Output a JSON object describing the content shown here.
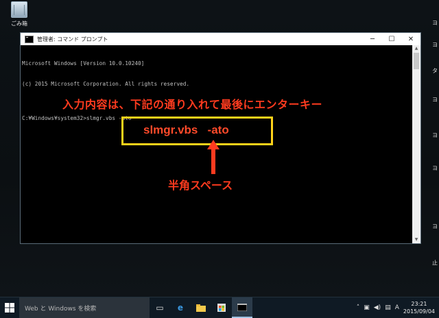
{
  "desktop": {
    "recycle_bin_label": "ごみ箱",
    "right_strip": [
      "ヨ",
      "ヨ",
      "タ",
      "ヨ",
      "ヨ",
      "ヨ",
      "ヨ",
      "止"
    ]
  },
  "window": {
    "title": "管理者: コマンド プロンプト",
    "minimize": "─",
    "maximize": "☐",
    "close": "✕",
    "console_lines": [
      "Microsoft Windows [Version 10.0.10240]",
      "(c) 2015 Microsoft Corporation. All rights reserved.",
      "",
      "C:¥Windows¥system32>slmgr.vbs -ato"
    ]
  },
  "annotations": {
    "instruction": "入力内容は、下記の通り入れて最後にエンターキー",
    "command": "slmgr.vbs   -ato",
    "space_note": "半角スペース",
    "arrow_color": "#ff3b1f",
    "box_color": "#ffd21a"
  },
  "taskbar": {
    "search_placeholder": "Web と Windows を検索",
    "language": "A",
    "time": "23:21",
    "date": "2015/09/04"
  }
}
